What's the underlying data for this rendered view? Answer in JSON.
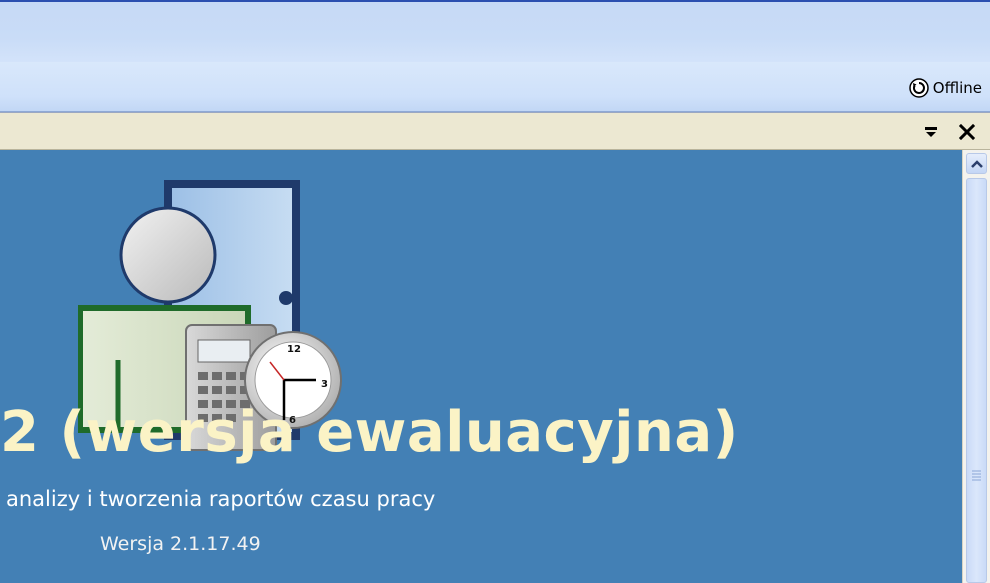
{
  "status_bar": {
    "offline_label": "Offline",
    "offline_icon": "sync-circle-icon"
  },
  "pane_header": {
    "options_icon": "pane-options-icon",
    "close_icon": "close-icon"
  },
  "splash": {
    "title": "2 (wersja ewaluacyjna)",
    "subtitle": "analizy i tworzenia raportów czasu pracy",
    "version": "Wersja 2.1.17.49",
    "artwork_icons": [
      "door-icon",
      "person-icon",
      "calculator-icon",
      "clock-icon"
    ]
  },
  "colors": {
    "content_background": "#4380b5",
    "title_color": "#fbf3c6",
    "pane_header_background": "#ece8d2",
    "toolbar_blue": "#c9dcf7"
  }
}
